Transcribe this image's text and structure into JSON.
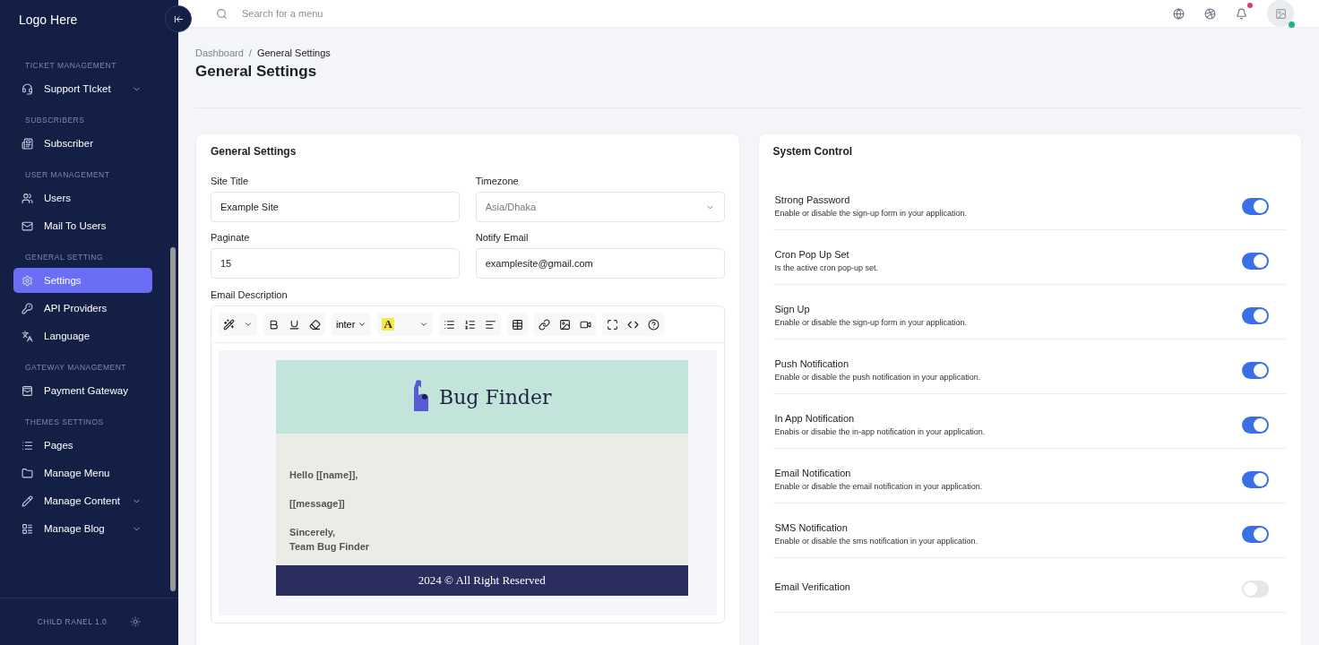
{
  "sidebar": {
    "logo": "Logo Here",
    "sections": [
      {
        "title": "TICKET MANAGEMENT",
        "items": [
          {
            "label": "Support TIcket",
            "submenu": true,
            "selected": false
          }
        ]
      },
      {
        "title": "SUBSCRIBERS",
        "items": [
          {
            "label": "Subscriber",
            "submenu": false,
            "selected": false
          }
        ]
      },
      {
        "title": "USER MANAGEMENT",
        "items": [
          {
            "label": "Users",
            "submenu": false,
            "selected": false
          },
          {
            "label": "Mail To Users",
            "submenu": false,
            "selected": false
          }
        ]
      },
      {
        "title": "GENERAL SETTING",
        "items": [
          {
            "label": "Settings",
            "submenu": false,
            "selected": true
          },
          {
            "label": "API Providers",
            "submenu": false,
            "selected": false
          },
          {
            "label": "Language",
            "submenu": false,
            "selected": false
          }
        ]
      },
      {
        "title": "GATEWAY MANAGEMENT",
        "items": [
          {
            "label": "Payment Gateway",
            "submenu": false,
            "selected": false
          }
        ]
      },
      {
        "title": "THEMES SETTINOS",
        "items": [
          {
            "label": "Pages",
            "submenu": false,
            "selected": false
          },
          {
            "label": "Manage Menu",
            "submenu": false,
            "selected": false
          },
          {
            "label": "Manage Content",
            "submenu": true,
            "selected": false
          },
          {
            "label": "Manage Blog",
            "submenu": true,
            "selected": false
          }
        ]
      }
    ],
    "footer": "CHILD RANEL 1.0"
  },
  "topbar": {
    "search": {
      "placeholder": "Search for a menu"
    },
    "notification_dot": true,
    "online": true
  },
  "breadcrumb": {
    "parent": "Dashboard",
    "separator": "/",
    "current": "General Settings"
  },
  "page_title": "General Settings",
  "general_settings": {
    "title": "General Settings",
    "fields": [
      {
        "label": "Site Title",
        "value": "Example Site",
        "kind": "text"
      },
      {
        "label": "Timezone",
        "value": "Asia/Dhaka",
        "kind": "select"
      },
      {
        "label": "Paginate",
        "value": "15",
        "kind": "text"
      },
      {
        "label": "Notify Email",
        "value": "examplesite@gmail.com",
        "kind": "text"
      }
    ],
    "editor": {
      "label": "Email Description",
      "font": "inter",
      "highlight": "A",
      "brand": "Bug Finder",
      "lines": [
        "Hello [[name]],",
        "[[message]]",
        "Sincerely,",
        "Team Bug Finder"
      ],
      "footer": "2024 © All Right Reserved"
    }
  },
  "system_control": {
    "title": "System Control",
    "items": [
      {
        "title": "Strong Password",
        "description": "Enable or disable the sign-up form in your application.",
        "on": true
      },
      {
        "title": "Cron Pop Up Set",
        "description": "Is the active cron pop-up set.",
        "on": true
      },
      {
        "title": "Sign Up",
        "description": "Enable or disable the sign-up form in your application.",
        "on": true
      },
      {
        "title": "Push Notification",
        "description": "Enable or disable the push notification in your application.",
        "on": true
      },
      {
        "title": "In App Notification",
        "description": "Enabis or disabie the in-app notification in your application.",
        "on": true
      },
      {
        "title": "Email Notification",
        "description": "Enable or disable the email notification in your application.",
        "on": true
      },
      {
        "title": "SMS Notification",
        "description": "Enable or disable the sms notification in your application.",
        "on": true
      },
      {
        "title": "Email Verification",
        "on": false
      }
    ]
  }
}
